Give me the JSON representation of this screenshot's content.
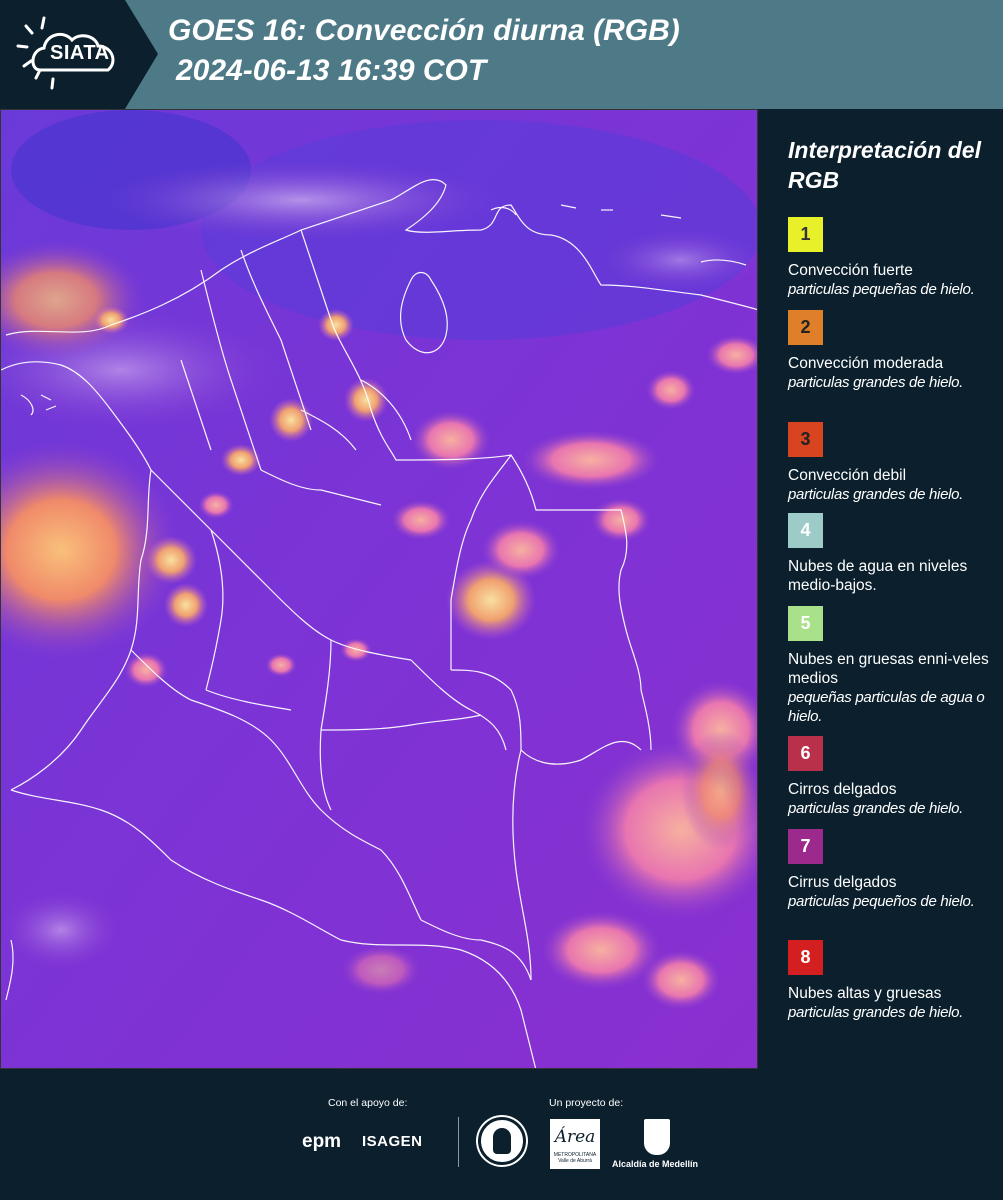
{
  "header": {
    "logo": "SIATA",
    "title_line1": "GOES 16: Convección diurna (RGB)",
    "title_line2": "2024-06-13 16:39 COT"
  },
  "legend": {
    "title": "Interpretación del RGB",
    "items": [
      {
        "number": "1",
        "color": "#e8f02a",
        "text_color": "#333333",
        "label": "Convección fuerte",
        "note": "particulas pequeñas de hielo."
      },
      {
        "number": "2",
        "color": "#e07f2a",
        "text_color": "#222222",
        "label": "Convección moderada",
        "note": "particulas grandes de hielo."
      },
      {
        "number": "3",
        "color": "#d8441f",
        "text_color": "#222222",
        "label": "Convección debil",
        "note": "particulas grandes de hielo."
      },
      {
        "number": "4",
        "color": "#9ccbc8",
        "text_color": "#ffffff",
        "label": "Nubes de agua en niveles medio-bajos.",
        "note": ""
      },
      {
        "number": "5",
        "color": "#a9e08a",
        "text_color": "#ffffff",
        "label": "Nubes en gruesas enni-veles medios",
        "note": "pequeñas particulas de agua o hielo."
      },
      {
        "number": "6",
        "color": "#b8304a",
        "text_color": "#ffffff",
        "label": "Cirros delgados",
        "note": "particulas grandes de hielo."
      },
      {
        "number": "7",
        "color": "#9c2a8c",
        "text_color": "#ffffff",
        "label": "Cirrus delgados",
        "note": "particulas pequeños de hielo."
      },
      {
        "number": "8",
        "color": "#d31f1f",
        "text_color": "#ffffff",
        "label": "Nubes altas y gruesas",
        "note": "particulas grandes de hielo."
      }
    ]
  },
  "footer": {
    "support_label": "Con el apoyo de:",
    "project_label": "Un proyecto de:",
    "sponsors": [
      "epm",
      "ISAGEN"
    ],
    "area_logo": "Área",
    "area_sub": "METROPOLITANA Valle de Aburrá",
    "medellin": "Alcaldía de Medellín"
  }
}
